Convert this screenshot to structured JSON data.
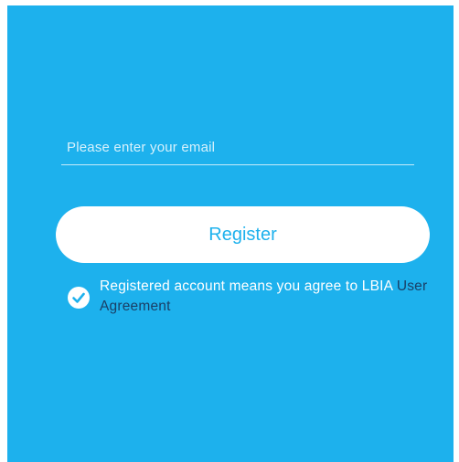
{
  "colors": {
    "background": "#1db1ed",
    "button_bg": "#ffffff",
    "button_text": "#1db1ed",
    "link": "#1a3f66"
  },
  "form": {
    "email_placeholder": "Please enter your email",
    "email_value": "",
    "register_label": "Register",
    "agree_checked": true,
    "agree_text": "Registered account means you agree to ",
    "agree_brand": "LBIA ",
    "agree_link": "User Agreement"
  },
  "icons": {
    "checkbox": "check-circle-icon"
  }
}
